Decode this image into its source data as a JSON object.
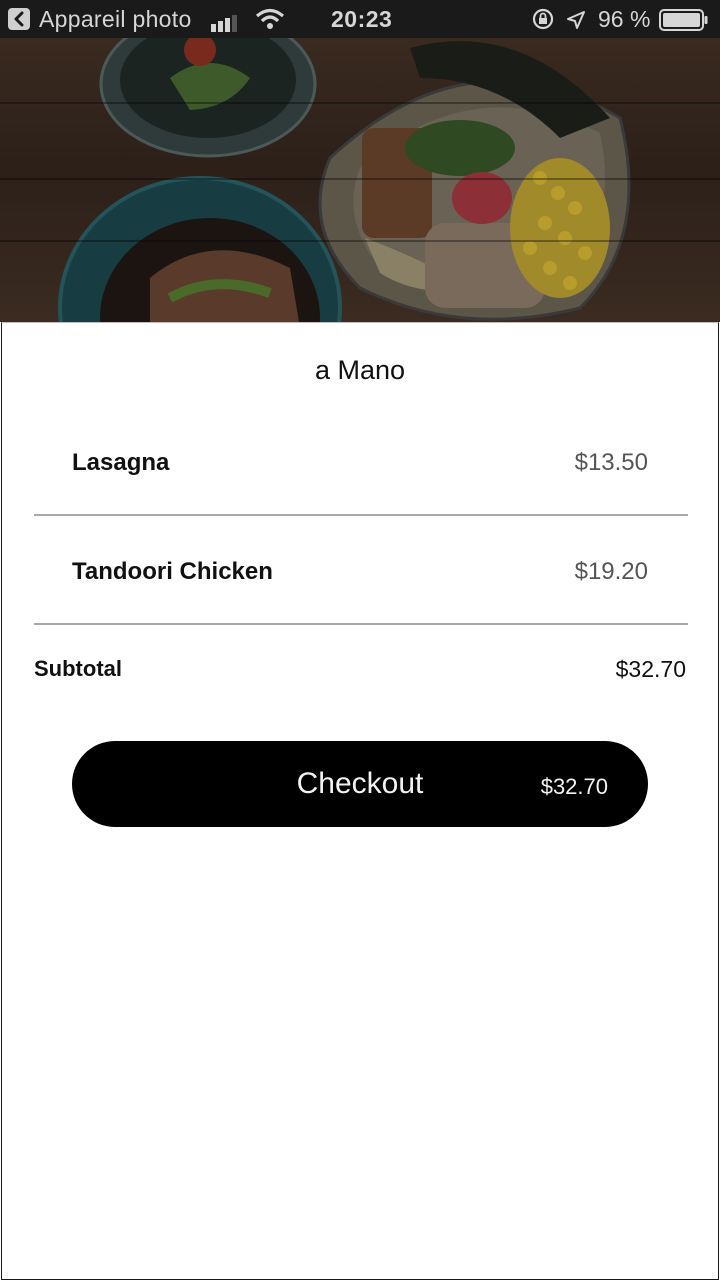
{
  "status_bar": {
    "back_app": "Appareil photo",
    "time": "20:23",
    "battery_percent": "96 %",
    "icons": [
      "back-arrow-icon",
      "signal-icon",
      "wifi-icon",
      "rotation-lock-icon",
      "location-arrow-icon",
      "battery-icon"
    ]
  },
  "hero": {
    "image": "food-photo-ramen-bowls"
  },
  "cart": {
    "restaurant": "a Mano",
    "items": [
      {
        "name": "Lasagna",
        "price": "$13.50"
      },
      {
        "name": "Tandoori Chicken",
        "price": "$19.20"
      }
    ],
    "subtotal_label": "Subtotal",
    "subtotal_value": "$32.70"
  },
  "checkout": {
    "label": "Checkout",
    "amount": "$32.70"
  },
  "colors": {
    "button": "#000000",
    "status_bar": "#1a1a1a",
    "price_text": "#555555"
  }
}
